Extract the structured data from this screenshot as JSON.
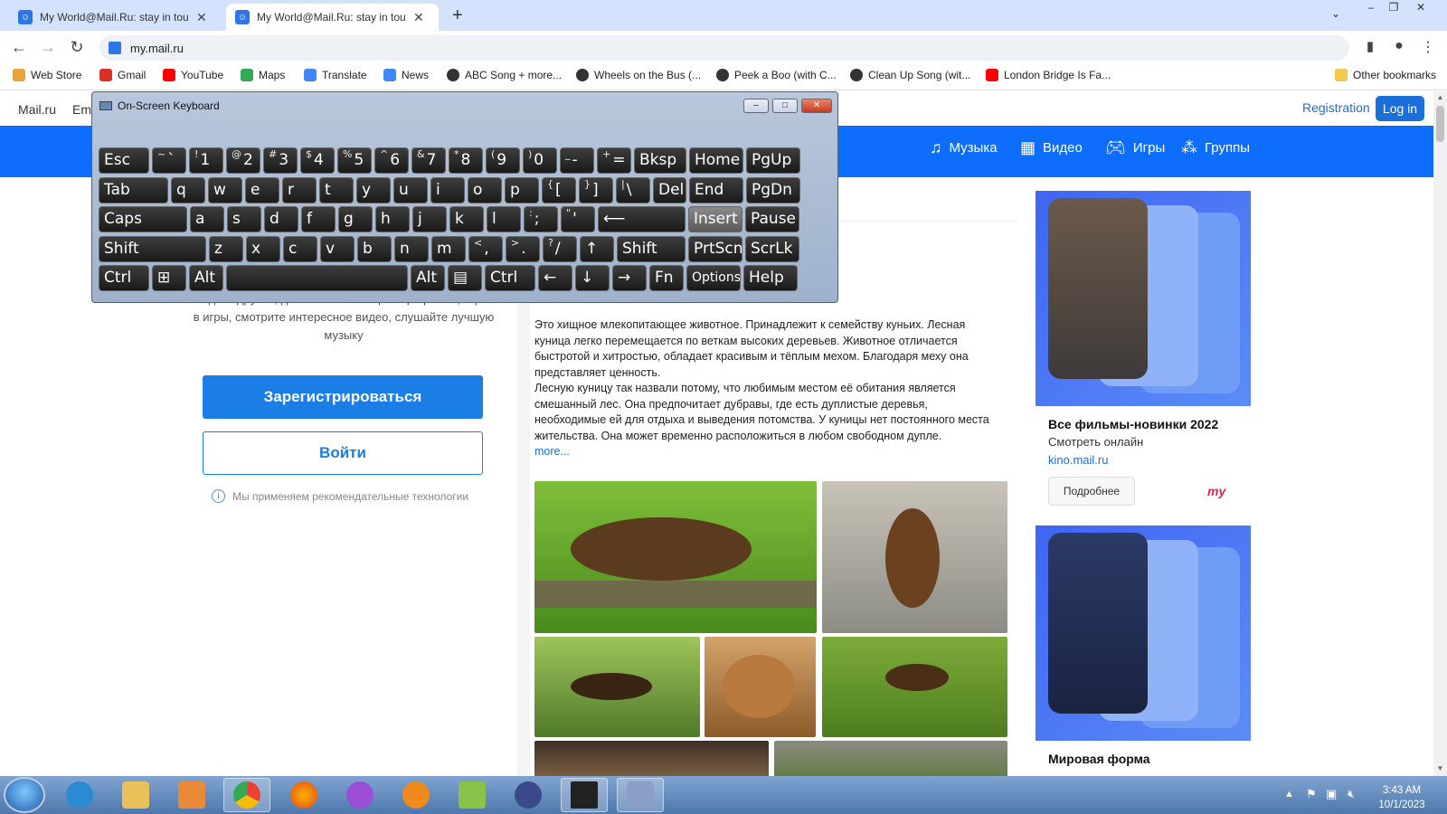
{
  "browser": {
    "tabs": [
      {
        "title": "My World@Mail.Ru: stay in touch",
        "active": false
      },
      {
        "title": "My World@Mail.Ru: stay in touch",
        "active": true
      }
    ],
    "url": "my.mail.ru",
    "bookmarks": [
      {
        "label": "Web Store",
        "color": "#e8a33a"
      },
      {
        "label": "Gmail",
        "color": "#d93025"
      },
      {
        "label": "YouTube",
        "color": "#ff0000"
      },
      {
        "label": "Maps",
        "color": "#34a853"
      },
      {
        "label": "Translate",
        "color": "#4285f4"
      },
      {
        "label": "News",
        "color": "#4285f4"
      },
      {
        "label": "ABC Song + more...",
        "color": "#333333"
      },
      {
        "label": "Wheels on the Bus (...",
        "color": "#333333"
      },
      {
        "label": "Peek a Boo (with C...",
        "color": "#333333"
      },
      {
        "label": "Clean Up Song (wit...",
        "color": "#333333"
      },
      {
        "label": "London Bridge Is Fa...",
        "color": "#ff0000"
      }
    ],
    "other_bookmarks": "Other bookmarks"
  },
  "page": {
    "topnav": [
      "Mail.ru",
      "Ema"
    ],
    "registration": "Registration",
    "login": "Log in",
    "bluenav": [
      {
        "label": "Музыка",
        "icon": "music-icon"
      },
      {
        "label": "Видео",
        "icon": "video-icon"
      },
      {
        "label": "Игры",
        "icon": "gamepad-icon"
      },
      {
        "label": "Группы",
        "icon": "groups-icon"
      }
    ],
    "tagline": "Находите друзей, делитесь с ними фотографиями, играйте в игры, смотрите интересное видео, слушайте лучшую музыку",
    "register_button": "Зарегистрироваться",
    "login_button": "Войти",
    "recommendation_note": "Мы применяем рекомендательные технологии",
    "article": {
      "paragraph1": "Это хищное млекопитающее животное. Принадлежит к семейству куньих. Лесная куница легко перемещается по веткам высоких деревьев. Животное отличается быстротой и хитростью, обладает красивым и тёплым мехом. Благодаря меху она представляет ценность.",
      "paragraph2": "Лесную куницу так назвали потому, что любимым местом её обитания является смешанный лес. Она предпочитает дубравы, где есть дуплистые деревья, необходимые ей для отдыха и выведения потомства. У куницы нет постоянного места жительства. Она может временно расположиться в любом свободном дупле.",
      "more": "more..."
    },
    "ads": [
      {
        "title": "Все фильмы-новинки 2022",
        "subtitle": "Смотреть онлайн",
        "link": "kino.mail.ru",
        "button": "Подробнее",
        "logo": "my"
      },
      {
        "title": "Мировая форма"
      }
    ]
  },
  "osk": {
    "title": "On-Screen Keyboard",
    "rows": [
      [
        [
          "Esc",
          ""
        ],
        [
          "` ",
          "~"
        ],
        [
          "1",
          "!"
        ],
        [
          "2",
          "@"
        ],
        [
          "3",
          "#"
        ],
        [
          "4",
          "$"
        ],
        [
          "5",
          "%"
        ],
        [
          "6",
          "^"
        ],
        [
          "7",
          "&"
        ],
        [
          "8",
          "*"
        ],
        [
          "9",
          "("
        ],
        [
          "0",
          ")"
        ],
        [
          "-",
          "_"
        ],
        [
          "=",
          "+"
        ],
        [
          "Bksp",
          ""
        ],
        [
          "Home",
          ""
        ],
        [
          "PgUp",
          ""
        ]
      ],
      [
        [
          "Tab",
          ""
        ],
        [
          "q",
          ""
        ],
        [
          "w",
          ""
        ],
        [
          "e",
          ""
        ],
        [
          "r",
          ""
        ],
        [
          "t",
          ""
        ],
        [
          "y",
          ""
        ],
        [
          "u",
          ""
        ],
        [
          "i",
          ""
        ],
        [
          "o",
          ""
        ],
        [
          "p",
          ""
        ],
        [
          "[",
          "{"
        ],
        [
          "]",
          "}"
        ],
        [
          "\\",
          "|"
        ],
        [
          "Del",
          ""
        ],
        [
          "End",
          ""
        ],
        [
          "PgDn",
          ""
        ]
      ],
      [
        [
          "Caps",
          ""
        ],
        [
          "a",
          ""
        ],
        [
          "s",
          ""
        ],
        [
          "d",
          ""
        ],
        [
          "f",
          ""
        ],
        [
          "g",
          ""
        ],
        [
          "h",
          ""
        ],
        [
          "j",
          ""
        ],
        [
          "k",
          ""
        ],
        [
          "l",
          ""
        ],
        [
          ";",
          ":"
        ],
        [
          "'",
          "\""
        ],
        [
          "⟵",
          ""
        ],
        [
          "Insert",
          ""
        ],
        [
          "Pause",
          ""
        ]
      ],
      [
        [
          "Shift",
          ""
        ],
        [
          "z",
          ""
        ],
        [
          "x",
          ""
        ],
        [
          "c",
          ""
        ],
        [
          "v",
          ""
        ],
        [
          "b",
          ""
        ],
        [
          "n",
          ""
        ],
        [
          "m",
          ""
        ],
        [
          ",",
          "<"
        ],
        [
          ".",
          ">"
        ],
        [
          "/",
          "?"
        ],
        [
          "↑",
          ""
        ],
        [
          "Shift",
          ""
        ],
        [
          "PrtScn",
          ""
        ],
        [
          "ScrLk",
          ""
        ]
      ],
      [
        [
          "Ctrl",
          ""
        ],
        [
          "⊞",
          ""
        ],
        [
          "Alt",
          ""
        ],
        [
          "",
          ""
        ],
        [
          "Alt",
          ""
        ],
        [
          "▤",
          ""
        ],
        [
          "Ctrl",
          ""
        ],
        [
          "←",
          ""
        ],
        [
          "↓",
          ""
        ],
        [
          "→",
          ""
        ],
        [
          "Fn",
          ""
        ],
        [
          "Options",
          ""
        ],
        [
          "Help",
          ""
        ]
      ]
    ]
  },
  "taskbar": {
    "time": "3:43 AM",
    "date": "10/1/2023"
  }
}
